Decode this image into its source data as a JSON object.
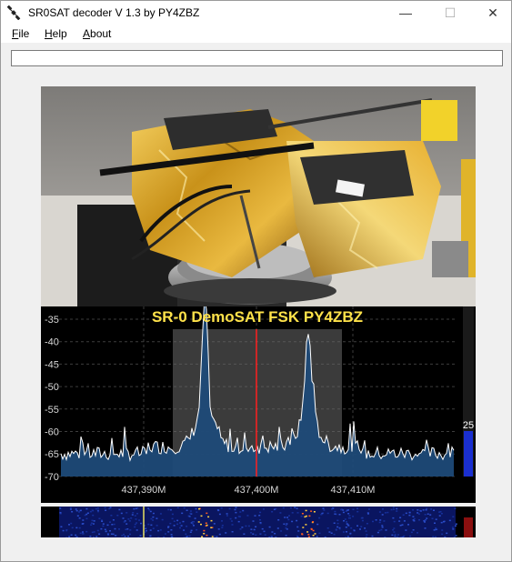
{
  "window": {
    "title": "SR0SAT decoder  V 1.3  by PY4ZBZ",
    "minimize_glyph": "—",
    "maximize_glyph": "☐",
    "close_glyph": "✕"
  },
  "menu": {
    "file": {
      "hotkey": "F",
      "rest": "ile"
    },
    "help": {
      "hotkey": "H",
      "rest": "elp"
    },
    "about": {
      "hotkey": "A",
      "rest": "bout"
    }
  },
  "input": {
    "value": ""
  },
  "spectrum": {
    "overlay_title": "SR-0 DemoSAT   FSK   PY4ZBZ",
    "level_value": "25",
    "level_fraction": 0.47,
    "y_ticks": [
      "-35",
      "-40",
      "-45",
      "-50",
      "-55",
      "-60",
      "-65",
      "-70"
    ],
    "x_ticks": [
      "437,390M",
      "437,400M",
      "437,410M"
    ],
    "colors": {
      "trace": "#ffffff",
      "fill": "#1e4a78",
      "marker": "#ff2020",
      "title": "#ffe24a",
      "passband": "#6b6b6b",
      "level_bar": "#1a2fd0"
    }
  }
}
